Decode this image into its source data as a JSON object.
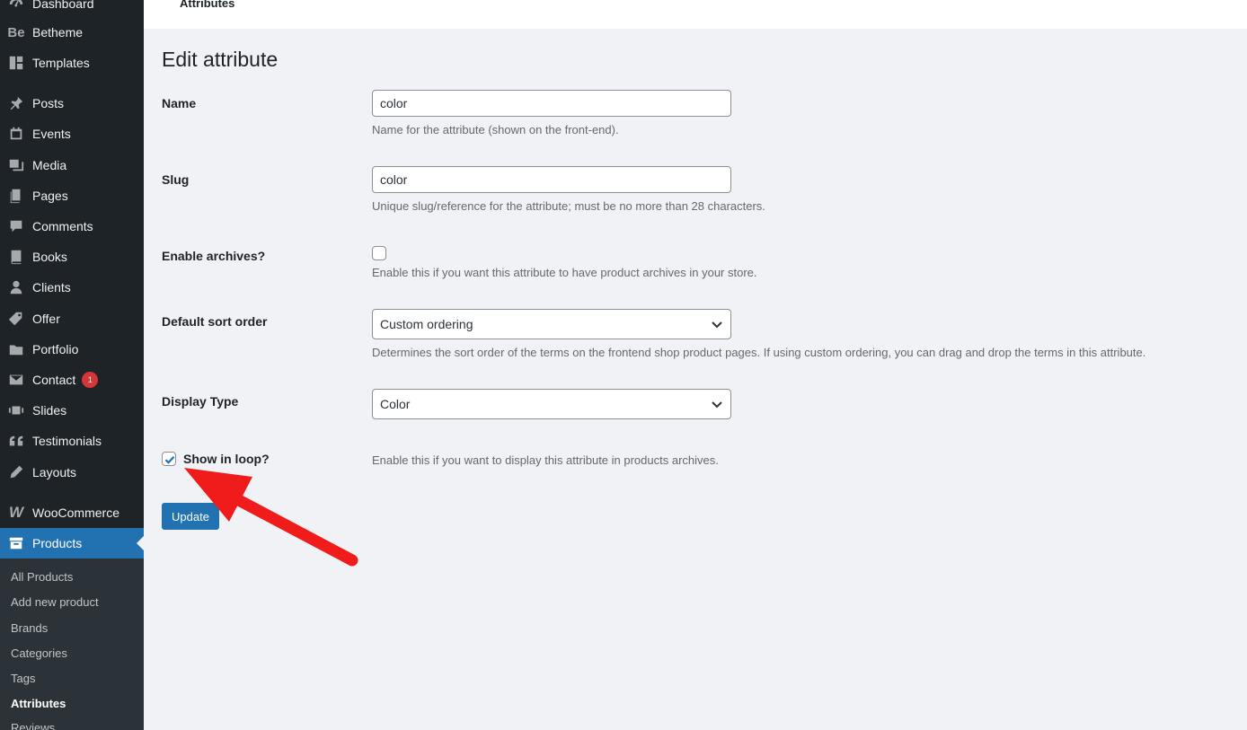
{
  "sidebar": {
    "items": [
      {
        "label": "Dashboard",
        "icon": "dashboard-icon"
      },
      {
        "label": "Betheme",
        "icon": "betheme-icon",
        "icon_text": "Be"
      },
      {
        "label": "Templates",
        "icon": "templates-icon"
      },
      {
        "label": "Posts",
        "icon": "pushpin-icon"
      },
      {
        "label": "Events",
        "icon": "calendar-icon"
      },
      {
        "label": "Media",
        "icon": "media-icon"
      },
      {
        "label": "Pages",
        "icon": "pages-icon"
      },
      {
        "label": "Comments",
        "icon": "comment-icon"
      },
      {
        "label": "Books",
        "icon": "book-icon"
      },
      {
        "label": "Clients",
        "icon": "clients-icon"
      },
      {
        "label": "Offer",
        "icon": "offer-icon"
      },
      {
        "label": "Portfolio",
        "icon": "portfolio-icon"
      },
      {
        "label": "Contact",
        "icon": "mail-icon",
        "badge": "1"
      },
      {
        "label": "Slides",
        "icon": "slides-icon"
      },
      {
        "label": "Testimonials",
        "icon": "quote-icon"
      },
      {
        "label": "Layouts",
        "icon": "pencil-icon"
      },
      {
        "label": "WooCommerce",
        "icon": "woocommerce-icon",
        "icon_text": "W"
      },
      {
        "label": "Products",
        "icon": "archive-icon",
        "active": true
      }
    ],
    "submenu": [
      {
        "label": "All Products"
      },
      {
        "label": "Add new product"
      },
      {
        "label": "Brands"
      },
      {
        "label": "Categories"
      },
      {
        "label": "Tags"
      },
      {
        "label": "Attributes",
        "current": true
      },
      {
        "label": "Reviews"
      }
    ]
  },
  "topbar": {
    "tab_label": "Attributes"
  },
  "page": {
    "title": "Edit attribute",
    "name": {
      "label": "Name",
      "value": "color",
      "description": "Name for the attribute (shown on the front-end)."
    },
    "slug": {
      "label": "Slug",
      "value": "color",
      "description": "Unique slug/reference for the attribute; must be no more than 28 characters."
    },
    "archives": {
      "label": "Enable archives?",
      "checked": false,
      "description": "Enable this if you want this attribute to have product archives in your store."
    },
    "sort_order": {
      "label": "Default sort order",
      "selected": "Custom ordering",
      "description": "Determines the sort order of the terms on the frontend shop product pages. If using custom ordering, you can drag and drop the terms in this attribute."
    },
    "display_type": {
      "label": "Display Type",
      "selected": "Color"
    },
    "show_in_loop": {
      "label": "Show in loop?",
      "checked": true,
      "description": "Enable this if you want to display this attribute in products archives."
    },
    "update_label": "Update"
  },
  "colors": {
    "sidebar_bg": "#1d2327",
    "submenu_bg": "#2c3338",
    "accent": "#2271b1",
    "badge": "#d63638",
    "annotation_arrow": "#f01c1c"
  }
}
